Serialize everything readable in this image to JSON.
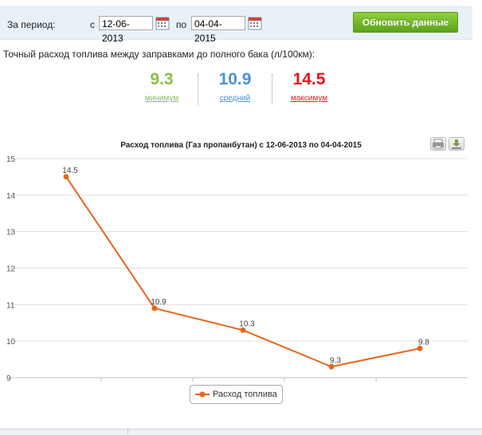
{
  "filter": {
    "period_label": "За период:",
    "from_label": "с",
    "from_date": "12-06-2013",
    "to_label": "по",
    "to_date": "04-04-2015",
    "refresh_label": "Обновить данные"
  },
  "consumption_caption": "Точный расход топлива между заправками до полного бака (л/100км):",
  "stats": {
    "min": {
      "value": "9.3",
      "label": "минимум",
      "color": "#8bbf3f"
    },
    "avg": {
      "value": "10.9",
      "label": "средний",
      "color": "#4a90d9"
    },
    "max": {
      "value": "14.5",
      "label": "максимум",
      "color": "#e8151b"
    }
  },
  "chart_data": {
    "type": "line",
    "title": "Расход топлива (Газ пропанбутан) с 12-06-2013 по 04-04-2015",
    "ylim": [
      9,
      15
    ],
    "yticks": [
      "15",
      "14",
      "13",
      "12",
      "11",
      "10",
      "9"
    ],
    "series": [
      {
        "name": "Расход топлива",
        "color": "#e8651a",
        "values": [
          14.5,
          10.9,
          10.3,
          9.3,
          9.8
        ]
      }
    ],
    "labels": [
      "14.5",
      "10.9",
      "10.3",
      "9.3",
      "9.8"
    ],
    "grid": true,
    "legend": "bottom"
  }
}
